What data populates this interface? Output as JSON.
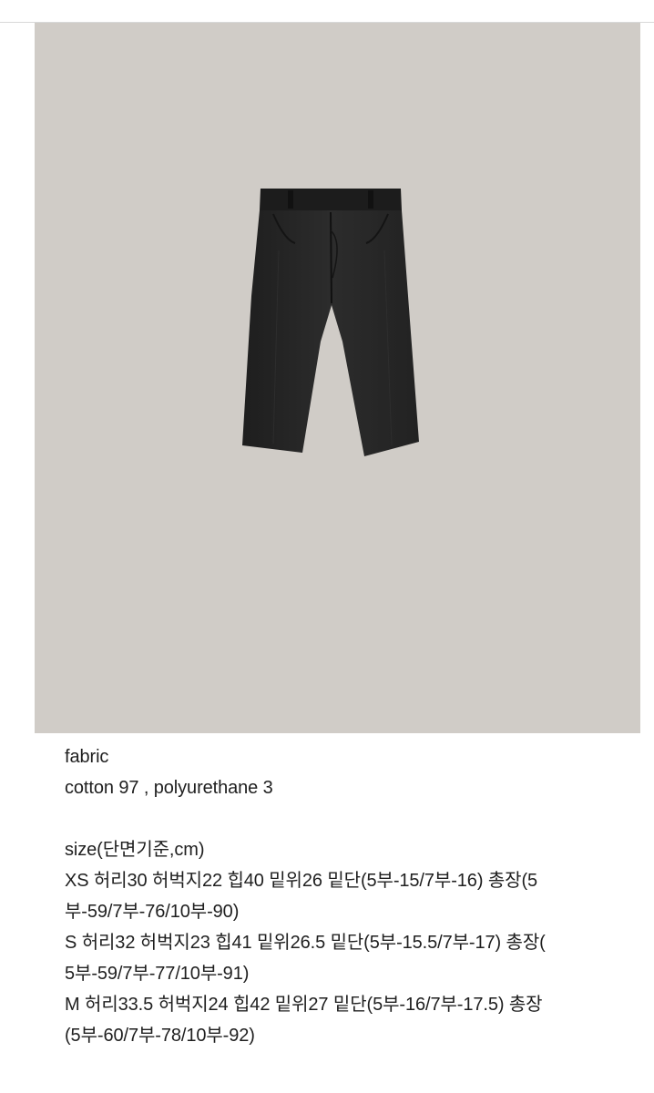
{
  "product_image": {
    "icon": "cropped-pants-icon",
    "background_color": "#d0ccc7",
    "garment_color": "#262626"
  },
  "description": {
    "fabric_heading": "fabric",
    "fabric_value": "cotton 97 , polyurethane 3",
    "size_heading": "size(단면기준,cm)",
    "sizes": [
      {
        "line1": "XS 허리30 허벅지22 힙40 밑위26 밑단(5부-15/7부-16) 총장(5",
        "line2": "부-59/7부-76/10부-90)"
      },
      {
        "line1": "S 허리32 허벅지23 힙41 밑위26.5 밑단(5부-15.5/7부-17) 총장(",
        "line2": "5부-59/7부-77/10부-91)"
      },
      {
        "line1": "M 허리33.5 허벅지24 힙42 밑위27 밑단(5부-16/7부-17.5) 총장",
        "line2": "(5부-60/7부-78/10부-92)"
      }
    ]
  }
}
